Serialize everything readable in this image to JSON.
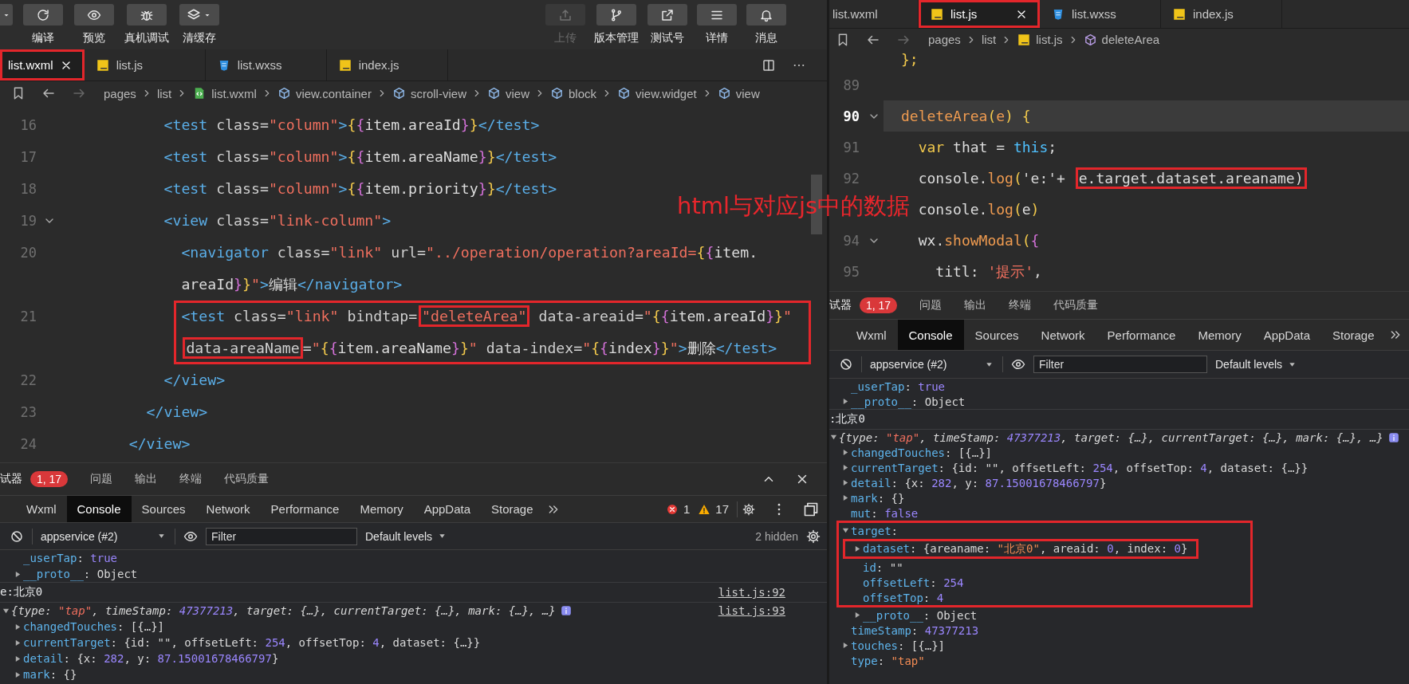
{
  "annotation_text": "html与对应js中的数据",
  "left": {
    "toolbar": {
      "left_tools": [
        {
          "kind": "compile",
          "label": "编译",
          "disabled": false
        },
        {
          "kind": "preview",
          "label": "预览",
          "disabled": false
        },
        {
          "kind": "debug",
          "label": "真机调试",
          "disabled": false
        },
        {
          "kind": "cache",
          "label": "清缓存",
          "disabled": false,
          "dropdown": true
        }
      ],
      "right_tools": [
        {
          "kind": "upload",
          "label": "上传",
          "disabled": true
        },
        {
          "kind": "version",
          "label": "版本管理",
          "disabled": false
        },
        {
          "kind": "test",
          "label": "测试号",
          "disabled": false
        },
        {
          "kind": "details",
          "label": "详情",
          "disabled": false
        },
        {
          "kind": "messages",
          "label": "消息",
          "disabled": false
        }
      ]
    },
    "tabs": [
      {
        "label": "list.wxml",
        "kind": "wxml",
        "selected": true,
        "boxed": true
      },
      {
        "label": "list.js",
        "kind": "js",
        "selected": false,
        "boxed": false
      },
      {
        "label": "list.wxss",
        "kind": "css",
        "selected": false,
        "boxed": false
      },
      {
        "label": "index.js",
        "kind": "js",
        "selected": false,
        "boxed": false
      }
    ],
    "breadcrumb": [
      {
        "text": "pages",
        "kind": "path"
      },
      {
        "text": "list",
        "kind": "path"
      },
      {
        "text": "list.wxml",
        "kind": "wxml"
      },
      {
        "text": "view.container",
        "kind": "element"
      },
      {
        "text": "scroll-view",
        "kind": "element"
      },
      {
        "text": "view",
        "kind": "element"
      },
      {
        "text": "block",
        "kind": "element"
      },
      {
        "text": "view.widget",
        "kind": "element"
      },
      {
        "text": "view",
        "kind": "element"
      }
    ],
    "code": [
      {
        "number": "16",
        "fold": false,
        "boxed": false,
        "segments": [
          {
            "tokens": [
              {
                "kind": "tag",
                "text": "          <test"
              },
              {
                "kind": "attr",
                "text": " class"
              },
              {
                "kind": "p",
                "text": "="
              },
              {
                "kind": "str",
                "text": "\"column\""
              },
              {
                "kind": "tag",
                "text": ">"
              },
              {
                "kind": "b1",
                "text": "{"
              },
              {
                "kind": "b2",
                "text": "{"
              },
              {
                "kind": "txt",
                "text": "item.areaId"
              },
              {
                "kind": "b2",
                "text": "}"
              },
              {
                "kind": "b1",
                "text": "}"
              },
              {
                "kind": "tag",
                "text": "</test>"
              }
            ]
          }
        ]
      },
      {
        "number": "17",
        "fold": false,
        "boxed": false,
        "segments": [
          {
            "tokens": [
              {
                "kind": "tag",
                "text": "          <test"
              },
              {
                "kind": "attr",
                "text": " class"
              },
              {
                "kind": "p",
                "text": "="
              },
              {
                "kind": "str",
                "text": "\"column\""
              },
              {
                "kind": "tag",
                "text": ">"
              },
              {
                "kind": "b1",
                "text": "{"
              },
              {
                "kind": "b2",
                "text": "{"
              },
              {
                "kind": "txt",
                "text": "item.areaName"
              },
              {
                "kind": "b2",
                "text": "}"
              },
              {
                "kind": "b1",
                "text": "}"
              },
              {
                "kind": "tag",
                "text": "</test>"
              }
            ]
          }
        ]
      },
      {
        "number": "18",
        "fold": false,
        "boxed": false,
        "segments": [
          {
            "tokens": [
              {
                "kind": "tag",
                "text": "          <test"
              },
              {
                "kind": "attr",
                "text": " class"
              },
              {
                "kind": "p",
                "text": "="
              },
              {
                "kind": "str",
                "text": "\"column\""
              },
              {
                "kind": "tag",
                "text": ">"
              },
              {
                "kind": "b1",
                "text": "{"
              },
              {
                "kind": "b2",
                "text": "{"
              },
              {
                "kind": "txt",
                "text": "item.priority"
              },
              {
                "kind": "b2",
                "text": "}"
              },
              {
                "kind": "b1",
                "text": "}"
              },
              {
                "kind": "tag",
                "text": "</test>"
              }
            ]
          }
        ]
      },
      {
        "number": "19",
        "fold": true,
        "boxed": false,
        "segments": [
          {
            "tokens": [
              {
                "kind": "tag",
                "text": "          <view"
              },
              {
                "kind": "attr",
                "text": " class"
              },
              {
                "kind": "p",
                "text": "="
              },
              {
                "kind": "str",
                "text": "\"link-column\""
              },
              {
                "kind": "tag",
                "text": ">"
              }
            ]
          }
        ]
      },
      {
        "number": "20",
        "fold": false,
        "boxed": false,
        "segments": [
          {
            "tokens": [
              {
                "kind": "tag",
                "text": "            <navigator"
              },
              {
                "kind": "attr",
                "text": " class"
              },
              {
                "kind": "p",
                "text": "="
              },
              {
                "kind": "str",
                "text": "\"link\""
              },
              {
                "kind": "attr",
                "text": " url"
              },
              {
                "kind": "p",
                "text": "="
              },
              {
                "kind": "str",
                "text": "\"../operation/operation?areaId="
              },
              {
                "kind": "b1",
                "text": "{"
              },
              {
                "kind": "b2",
                "text": "{"
              },
              {
                "kind": "txt",
                "text": "item."
              }
            ]
          },
          {
            "tokens": [
              {
                "kind": "txt",
                "text": "areaId"
              },
              {
                "kind": "b2",
                "text": "}"
              },
              {
                "kind": "b1",
                "text": "}"
              },
              {
                "kind": "str",
                "text": "\""
              },
              {
                "kind": "tag",
                "text": ">"
              },
              {
                "kind": "txt",
                "text": "编辑"
              },
              {
                "kind": "tag",
                "text": "</navigator>"
              }
            ]
          }
        ]
      },
      {
        "number": "21",
        "fold": false,
        "boxed": true,
        "segments": [
          {
            "tokens": [
              {
                "kind": "tag",
                "text": "            <test"
              },
              {
                "kind": "attr",
                "text": " class"
              },
              {
                "kind": "p",
                "text": "="
              },
              {
                "kind": "str",
                "text": "\"link\""
              },
              {
                "kind": "attr",
                "text": " bindtap"
              },
              {
                "kind": "p",
                "text": "="
              },
              {
                "kind": "str",
                "text": "\"deleteArea\"",
                "boxed": true
              },
              {
                "kind": "attr",
                "text": " data-areaid"
              },
              {
                "kind": "p",
                "text": "="
              },
              {
                "kind": "str",
                "text": "\""
              },
              {
                "kind": "b1",
                "text": "{"
              },
              {
                "kind": "b2",
                "text": "{"
              },
              {
                "kind": "txt",
                "text": "item.areaId"
              },
              {
                "kind": "b2",
                "text": "}"
              },
              {
                "kind": "b1",
                "text": "}"
              },
              {
                "kind": "str",
                "text": "\""
              }
            ]
          },
          {
            "tokens": [
              {
                "kind": "attr",
                "text": "data-areaName",
                "boxed": true
              },
              {
                "kind": "p",
                "text": "="
              },
              {
                "kind": "str",
                "text": "\""
              },
              {
                "kind": "b1",
                "text": "{"
              },
              {
                "kind": "b2",
                "text": "{"
              },
              {
                "kind": "txt",
                "text": "item.areaName"
              },
              {
                "kind": "b2",
                "text": "}"
              },
              {
                "kind": "b1",
                "text": "}"
              },
              {
                "kind": "str",
                "text": "\""
              },
              {
                "kind": "attr",
                "text": " data-index"
              },
              {
                "kind": "p",
                "text": "="
              },
              {
                "kind": "str",
                "text": "\""
              },
              {
                "kind": "b1",
                "text": "{"
              },
              {
                "kind": "b2",
                "text": "{"
              },
              {
                "kind": "txt",
                "text": "index"
              },
              {
                "kind": "b2",
                "text": "}"
              },
              {
                "kind": "b1",
                "text": "}"
              },
              {
                "kind": "str",
                "text": "\""
              },
              {
                "kind": "tag",
                "text": ">"
              },
              {
                "kind": "txt",
                "text": "删除"
              },
              {
                "kind": "tag",
                "text": "</test>"
              }
            ]
          }
        ]
      },
      {
        "number": "22",
        "fold": false,
        "boxed": false,
        "segments": [
          {
            "tokens": [
              {
                "kind": "tag",
                "text": "          </view>"
              }
            ]
          }
        ]
      },
      {
        "number": "23",
        "fold": false,
        "boxed": false,
        "segments": [
          {
            "tokens": [
              {
                "kind": "tag",
                "text": "        </view>"
              }
            ]
          }
        ]
      },
      {
        "number": "24",
        "fold": false,
        "boxed": false,
        "segments": [
          {
            "tokens": [
              {
                "kind": "tag",
                "text": "      </view>"
              }
            ]
          }
        ]
      }
    ],
    "devtools": {
      "title": "试器",
      "badge": "1, 17",
      "tabs": [
        "问题",
        "输出",
        "终端",
        "代码质量"
      ],
      "header_buttons": true,
      "panel_tabs": [
        {
          "label": "Wxml",
          "selected": false
        },
        {
          "label": "Console",
          "selected": true
        },
        {
          "label": "Sources",
          "selected": false
        },
        {
          "label": "Network",
          "selected": false
        },
        {
          "label": "Performance",
          "selected": false
        },
        {
          "label": "Memory",
          "selected": false
        },
        {
          "label": "AppData",
          "selected": false
        },
        {
          "label": "Storage",
          "selected": false
        }
      ],
      "errors": "1",
      "warnings": "17",
      "context": "appservice (#2)",
      "filter": {
        "placeholder": "Filter"
      },
      "levels": "Default levels",
      "hidden": "2 hidden",
      "console": [
        {
          "kind": "tail",
          "children": [
            {
              "tokens": [
                {
                  "kind": "key",
                  "text": "_userTap"
                },
                {
                  "kind": "p",
                  "text": ": "
                },
                {
                  "kind": "num",
                  "text": "true"
                }
              ]
            },
            {
              "expanded": false,
              "tokens": [
                {
                  "kind": "key",
                  "text": "__proto__"
                },
                {
                  "kind": "p",
                  "text": ": Object"
                }
              ]
            }
          ]
        },
        {
          "kind": "log",
          "text": "e:北京0",
          "source": "list.js:92"
        },
        {
          "kind": "object",
          "expanded": true,
          "info": true,
          "source": "list.js:93",
          "summary": [
            {
              "kind": "p",
              "text": "{type: "
            },
            {
              "kind": "str",
              "text": "\"tap\""
            },
            {
              "kind": "p",
              "text": ", timeStamp: "
            },
            {
              "kind": "num",
              "text": "47377213"
            },
            {
              "kind": "p",
              "text": ", target: {…}, currentTarget: {…}, mark: {…}, …}"
            }
          ],
          "children": [
            {
              "expanded": false,
              "tokens": [
                {
                  "kind": "key",
                  "text": "changedTouches"
                },
                {
                  "kind": "p",
                  "text": ": [{…}]"
                }
              ]
            },
            {
              "expanded": false,
              "tokens": [
                {
                  "kind": "key",
                  "text": "currentTarget"
                },
                {
                  "kind": "p",
                  "text": ": {id: \"\", offsetLeft: "
                },
                {
                  "kind": "num",
                  "text": "254"
                },
                {
                  "kind": "p",
                  "text": ", offsetTop: "
                },
                {
                  "kind": "num",
                  "text": "4"
                },
                {
                  "kind": "p",
                  "text": ", dataset: {…}}"
                }
              ]
            },
            {
              "expanded": false,
              "tokens": [
                {
                  "kind": "key",
                  "text": "detail"
                },
                {
                  "kind": "p",
                  "text": ": {x: "
                },
                {
                  "kind": "num",
                  "text": "282"
                },
                {
                  "kind": "p",
                  "text": ", y: "
                },
                {
                  "kind": "num",
                  "text": "87.15001678466797"
                },
                {
                  "kind": "p",
                  "text": "}"
                }
              ]
            },
            {
              "expanded": false,
              "tokens": [
                {
                  "kind": "key",
                  "text": "mark"
                },
                {
                  "kind": "p",
                  "text": ": {}"
                }
              ]
            }
          ]
        }
      ]
    }
  },
  "right": {
    "tabs": [
      {
        "label": "list.wxml",
        "kind": "wxml",
        "selected": false,
        "boxed": false
      },
      {
        "label": "list.js",
        "kind": "js",
        "selected": true,
        "boxed": true
      },
      {
        "label": "list.wxss",
        "kind": "css",
        "selected": false,
        "boxed": false
      },
      {
        "label": "index.js",
        "kind": "js",
        "selected": false,
        "boxed": false
      }
    ],
    "breadcrumb": [
      {
        "text": "pages",
        "kind": "path"
      },
      {
        "text": "list",
        "kind": "path"
      },
      {
        "text": "list.js",
        "kind": "js"
      },
      {
        "text": "deleteArea",
        "kind": "method"
      }
    ],
    "code": [
      {
        "fold": false,
        "current": false,
        "segments": [
          {
            "tokens": [
              {
                "kind": "b1",
                "text": "};"
              }
            ]
          }
        ]
      },
      {
        "number": "89",
        "fold": false,
        "current": false
      },
      {
        "number": "90",
        "fold": true,
        "current": true,
        "segments": [
          {
            "tokens": [
              {
                "kind": "fn",
                "text": "deleteArea"
              },
              {
                "kind": "b1",
                "text": "("
              },
              {
                "kind": "param",
                "text": "e"
              },
              {
                "kind": "b1",
                "text": ") {"
              }
            ]
          }
        ]
      },
      {
        "number": "91",
        "fold": false,
        "current": false,
        "segments": [
          {
            "tokens": [
              {
                "kind": "kw",
                "text": "  var"
              },
              {
                "kind": "txt",
                "text": " that"
              },
              {
                "kind": "p",
                "text": " = "
              },
              {
                "kind": "this",
                "text": "this"
              },
              {
                "kind": "p",
                "text": ";"
              }
            ]
          }
        ]
      },
      {
        "number": "92",
        "fold": false,
        "current": false,
        "segments": [
          {
            "tokens": [
              {
                "kind": "txt",
                "text": "  console"
              },
              {
                "kind": "p",
                "text": "."
              },
              {
                "kind": "fn",
                "text": "log"
              },
              {
                "kind": "b1",
                "text": "("
              },
              {
                "kind": "p",
                "text": "'e:'+ "
              },
              {
                "kind": "txt",
                "text": "e.target.dataset.areaname)",
                "boxed": true
              }
            ]
          }
        ]
      },
      {
        "fold": false,
        "current": false,
        "segments": [
          {
            "tokens": [
              {
                "kind": "txt",
                "text": "  console"
              },
              {
                "kind": "p",
                "text": "."
              },
              {
                "kind": "fn",
                "text": "log"
              },
              {
                "kind": "b1",
                "text": "("
              },
              {
                "kind": "txt",
                "text": "e"
              },
              {
                "kind": "b1",
                "text": ")"
              }
            ]
          }
        ]
      },
      {
        "number": "94",
        "fold": true,
        "current": false,
        "segments": [
          {
            "tokens": [
              {
                "kind": "txt",
                "text": "  wx"
              },
              {
                "kind": "p",
                "text": "."
              },
              {
                "kind": "fn",
                "text": "showModal"
              },
              {
                "kind": "b1",
                "text": "("
              },
              {
                "kind": "b2",
                "text": "{"
              }
            ]
          }
        ]
      },
      {
        "number": "95",
        "fold": false,
        "current": false,
        "segments": [
          {
            "tokens": [
              {
                "kind": "txt",
                "text": "    titl"
              },
              {
                "kind": "p",
                "text": ": "
              },
              {
                "kind": "str",
                "text": "'提示'"
              },
              {
                "kind": "p",
                "text": ","
              }
            ]
          }
        ]
      }
    ],
    "devtools": {
      "title": "试器",
      "badge": "1, 17",
      "tabs": [
        "问题",
        "输出",
        "终端",
        "代码质量"
      ],
      "header_buttons": false,
      "panel_tabs": [
        {
          "label": "Wxml",
          "selected": false
        },
        {
          "label": "Console",
          "selected": true
        },
        {
          "label": "Sources",
          "selected": false
        },
        {
          "label": "Network",
          "selected": false
        },
        {
          "label": "Performance",
          "selected": false
        },
        {
          "label": "Memory",
          "selected": false
        },
        {
          "label": "AppData",
          "selected": false
        },
        {
          "label": "Storage",
          "selected": false
        }
      ],
      "context": "appservice (#2)",
      "filter": {
        "placeholder": "Filter"
      },
      "levels": "Default levels",
      "console": [
        {
          "kind": "tail",
          "children": [
            {
              "tokens": [
                {
                  "kind": "key",
                  "text": "_userTap"
                },
                {
                  "kind": "p",
                  "text": ": "
                },
                {
                  "kind": "num",
                  "text": "true"
                }
              ]
            },
            {
              "expanded": false,
              "tokens": [
                {
                  "kind": "key",
                  "text": "__proto__"
                },
                {
                  "kind": "p",
                  "text": ": Object"
                }
              ]
            }
          ]
        },
        {
          "kind": "log",
          "text": ":北京0"
        },
        {
          "kind": "object",
          "expanded": true,
          "info": true,
          "summary": [
            {
              "kind": "p",
              "text": "{type: "
            },
            {
              "kind": "str",
              "text": "\"tap\""
            },
            {
              "kind": "p",
              "text": ", timeStamp: "
            },
            {
              "kind": "num",
              "text": "47377213"
            },
            {
              "kind": "p",
              "text": ", target: {…}, currentTarget: {…}, mark: {…}, …}"
            }
          ],
          "children": [
            {
              "expanded": false,
              "tokens": [
                {
                  "kind": "key",
                  "text": "changedTouches"
                },
                {
                  "kind": "p",
                  "text": ": [{…}]"
                }
              ]
            },
            {
              "expanded": false,
              "tokens": [
                {
                  "kind": "key",
                  "text": "currentTarget"
                },
                {
                  "kind": "p",
                  "text": ": {id: \"\", offsetLeft: "
                },
                {
                  "kind": "num",
                  "text": "254"
                },
                {
                  "kind": "p",
                  "text": ", offsetTop: "
                },
                {
                  "kind": "num",
                  "text": "4"
                },
                {
                  "kind": "p",
                  "text": ", dataset: {…}}"
                }
              ]
            },
            {
              "expanded": false,
              "tokens": [
                {
                  "kind": "key",
                  "text": "detail"
                },
                {
                  "kind": "p",
                  "text": ": {x: "
                },
                {
                  "kind": "num",
                  "text": "282"
                },
                {
                  "kind": "p",
                  "text": ", y: "
                },
                {
                  "kind": "num",
                  "text": "87.15001678466797"
                },
                {
                  "kind": "p",
                  "text": "}"
                }
              ]
            },
            {
              "expanded": false,
              "tokens": [
                {
                  "kind": "key",
                  "text": "mark"
                },
                {
                  "kind": "p",
                  "text": ": {}"
                }
              ]
            },
            {
              "tokens": [
                {
                  "kind": "key",
                  "text": "mut"
                },
                {
                  "kind": "p",
                  "text": ": "
                },
                {
                  "kind": "num",
                  "text": "false"
                }
              ]
            },
            {
              "expanded": true,
              "framed": true,
              "tokens": [
                {
                  "kind": "key",
                  "text": "target"
                },
                {
                  "kind": "p",
                  "text": ":"
                }
              ],
              "children": [
                {
                  "expanded": false,
                  "framed": true,
                  "tokens": [
                    {
                      "kind": "key",
                      "text": "dataset"
                    },
                    {
                      "kind": "p",
                      "text": ": {areaname: "
                    },
                    {
                      "kind": "str",
                      "text": "\"北京0\""
                    },
                    {
                      "kind": "p",
                      "text": ", areaid: "
                    },
                    {
                      "kind": "num",
                      "text": "0"
                    },
                    {
                      "kind": "p",
                      "text": ", index: "
                    },
                    {
                      "kind": "num",
                      "text": "0"
                    },
                    {
                      "kind": "p",
                      "text": "}"
                    }
                  ]
                },
                {
                  "tokens": [
                    {
                      "kind": "key",
                      "text": "id"
                    },
                    {
                      "kind": "p",
                      "text": ": \"\""
                    }
                  ]
                },
                {
                  "tokens": [
                    {
                      "kind": "key",
                      "text": "offsetLeft"
                    },
                    {
                      "kind": "p",
                      "text": ": "
                    },
                    {
                      "kind": "num",
                      "text": "254"
                    }
                  ]
                },
                {
                  "tokens": [
                    {
                      "kind": "key",
                      "text": "offsetTop"
                    },
                    {
                      "kind": "p",
                      "text": ": "
                    },
                    {
                      "kind": "num",
                      "text": "4"
                    }
                  ]
                }
              ],
              "rest_children": [
                {
                  "expanded": false,
                  "tokens": [
                    {
                      "kind": "key",
                      "text": "__proto__"
                    },
                    {
                      "kind": "p",
                      "text": ": Object"
                    }
                  ]
                }
              ]
            },
            {
              "tokens": [
                {
                  "kind": "key",
                  "text": "timeStamp"
                },
                {
                  "kind": "p",
                  "text": ": "
                },
                {
                  "kind": "num",
                  "text": "47377213"
                }
              ]
            },
            {
              "expanded": false,
              "tokens": [
                {
                  "kind": "key",
                  "text": "touches"
                },
                {
                  "kind": "p",
                  "text": ": [{…}]"
                }
              ]
            },
            {
              "tokens": [
                {
                  "kind": "key",
                  "text": "type"
                },
                {
                  "kind": "p",
                  "text": ": "
                },
                {
                  "kind": "str",
                  "text": "\"tap\""
                }
              ]
            }
          ]
        }
      ]
    }
  }
}
